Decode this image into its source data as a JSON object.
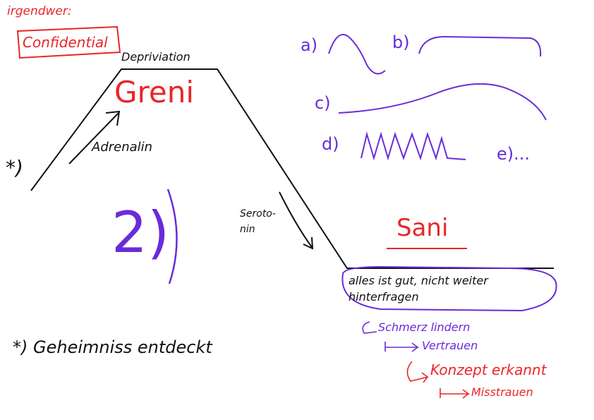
{
  "annotations": {
    "corner_label": "irgendwer:",
    "stamp": "Confidential",
    "peak_label": "Depriviation",
    "peak_name": "Greni",
    "arrow_left_label": "Adrenalin",
    "asterisk": "*)",
    "big_number": "2)",
    "arrow_right_label_line1": "Seroto-",
    "arrow_right_label_line2": "nin",
    "valley_name": "Sani",
    "bubble_line1": "alles ist gut, nicht weiter",
    "bubble_line2": "hinterfragen",
    "step1": "Schmerz lindern",
    "step2": "Vertrauen",
    "step3": "Konzept erkannt",
    "step4": "Misstrauen",
    "footnote": "*) Geheimniss entdeckt"
  },
  "curve_labels": {
    "a": "a)",
    "b": "b)",
    "c": "c)",
    "d": "d)",
    "e": "e)..."
  },
  "colors": {
    "red": "#e8262a",
    "purple": "#6a2bd9",
    "black": "#111111"
  }
}
